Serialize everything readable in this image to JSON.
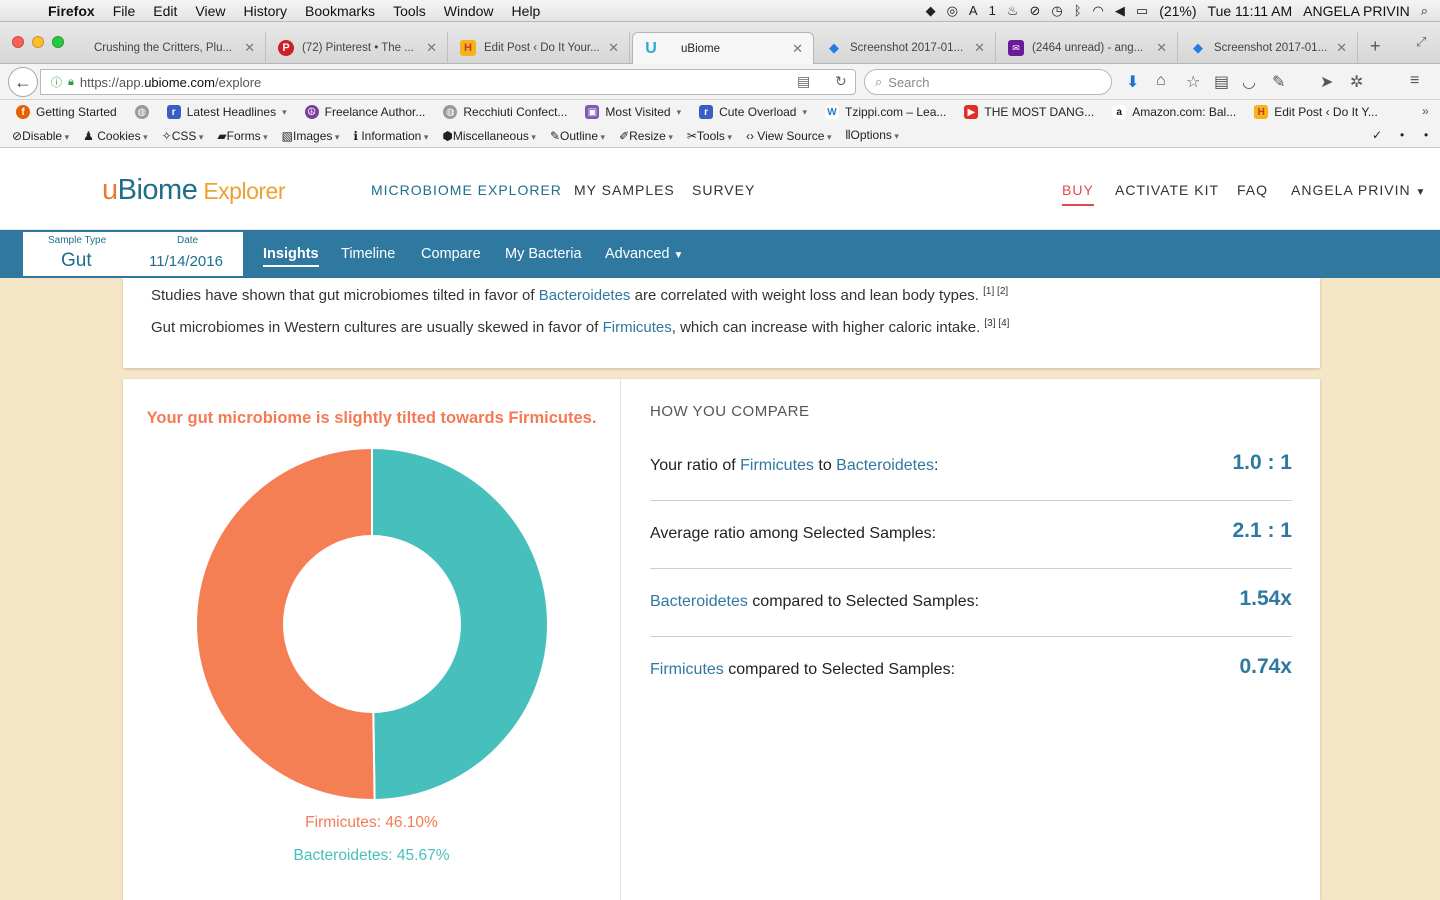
{
  "macos": {
    "app_name": "Firefox",
    "menus": [
      "File",
      "Edit",
      "View",
      "History",
      "Bookmarks",
      "Tools",
      "Window",
      "Help"
    ],
    "battery": "(21%)",
    "clock": "Tue 11:11 AM",
    "user": "ANGELA PRIVIN",
    "badge": "1"
  },
  "tabs": [
    {
      "title": "Crushing the Critters, Plu...",
      "icon": "blank-icon"
    },
    {
      "title": "(72) Pinterest • The ...",
      "icon": "pinterest-icon"
    },
    {
      "title": "Edit Post ‹ Do It Your...",
      "icon": "h-icon"
    },
    {
      "title": "uBiome",
      "icon": "ubiome-icon"
    },
    {
      "title": "Screenshot 2017-01...",
      "icon": "dropbox-icon"
    },
    {
      "title": "(2464 unread) - ang...",
      "icon": "mail-icon"
    },
    {
      "title": "Screenshot 2017-01...",
      "icon": "dropbox-icon"
    }
  ],
  "address": {
    "scheme": "https://app.",
    "host": "ubiome.com",
    "path": "/explore",
    "search_placeholder": "Search"
  },
  "bookmarks": [
    "Getting Started",
    "Latest Headlines",
    "Freelance Author...",
    "Recchiuti Confect...",
    "Most Visited",
    "Cute Overload",
    "Tzippi.com – Lea...",
    "THE MOST DANG...",
    "Amazon.com: Bal...",
    "Edit Post ‹ Do It Y..."
  ],
  "webdev": [
    "Disable",
    "Cookies",
    "CSS",
    "Forms",
    "Images",
    "Information",
    "Miscellaneous",
    "Outline",
    "Resize",
    "Tools",
    "View Source",
    "Options"
  ],
  "site": {
    "logo_u": "u",
    "logo_biome": "Biome",
    "logo_explorer": "Explorer",
    "nav": {
      "explorer": "MICROBIOME EXPLORER",
      "samples": "MY SAMPLES",
      "survey": "SURVEY",
      "buy": "BUY",
      "activate": "ACTIVATE KIT",
      "faq": "FAQ",
      "user": "ANGELA PRIVIN"
    }
  },
  "subnav": {
    "sample_type_label": "Sample Type",
    "sample_type": "Gut",
    "date_label": "Date",
    "date": "11/14/2016",
    "tabs": [
      "Insights",
      "Timeline",
      "Compare",
      "My Bacteria",
      "Advanced"
    ]
  },
  "intro": {
    "line1_pre": "Studies have shown that gut microbiomes tilted in favor of ",
    "line1_hl": "Bacteroidetes",
    "line1_post": " are correlated with weight loss and lean body types. ",
    "line1_refs": "[1] [2]",
    "line2_pre": "Gut microbiomes in Western cultures are usually skewed in favor of ",
    "line2_hl": "Firmicutes",
    "line2_post": ", which can increase with higher caloric intake. ",
    "line2_refs": "[3] [4]"
  },
  "insight": {
    "headline": "Your gut microbiome is slightly tilted towards Firmicutes.",
    "firmicutes_label": "Firmicutes: 46.10%",
    "bacteroidetes_label": "Bacteroidetes: 45.67%"
  },
  "chart_data": {
    "type": "pie",
    "categories": [
      "Firmicutes",
      "Bacteroidetes"
    ],
    "values": [
      46.1,
      45.67
    ],
    "colors": [
      "#f47f55",
      "#47bfbd"
    ]
  },
  "compare": {
    "heading": "HOW YOU COMPARE",
    "rows": [
      {
        "pre": "Your ratio of ",
        "hl1": "Firmicutes",
        "mid": " to ",
        "hl2": "Bacteroidetes",
        "post": ":",
        "value": "1.0 : 1"
      },
      {
        "pre": "Average ratio among Selected Samples:",
        "hl1": "",
        "mid": "",
        "hl2": "",
        "post": "",
        "value": "2.1 : 1"
      },
      {
        "pre": "",
        "hl1": "Bacteroidetes",
        "mid": " compared to Selected Samples:",
        "hl2": "",
        "post": "",
        "value": "1.54x"
      },
      {
        "pre": "",
        "hl1": "Firmicutes",
        "mid": " compared to Selected Samples:",
        "hl2": "",
        "post": "",
        "value": "0.74x"
      }
    ]
  }
}
